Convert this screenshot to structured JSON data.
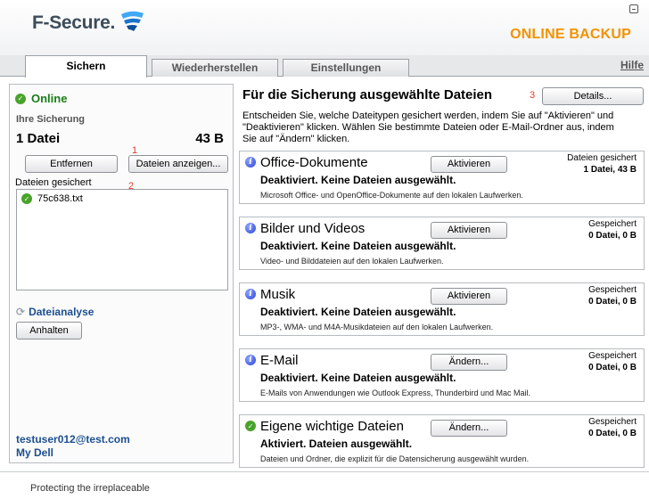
{
  "brand": {
    "name": "F-Secure.",
    "product": "ONLINE BACKUP"
  },
  "tabs": [
    {
      "label": "Sichern",
      "active": true
    },
    {
      "label": "Wiederherstellen",
      "active": false
    },
    {
      "label": "Einstellungen",
      "active": false
    }
  ],
  "help_label": "Hilfe",
  "left_panel": {
    "status": "Online",
    "backup_label": "Ihre Sicherung",
    "file_count": "1 Datei",
    "size": "43 B",
    "remove_button": "Entfernen",
    "show_files_button": "Dateien anzeigen...",
    "files_label": "Dateien gesichert",
    "files": [
      "75c638.txt"
    ],
    "analysis_label": "Dateianalyse",
    "pause_button": "Anhalten",
    "user_email": "testuser012@test.com",
    "user_link": "My Dell"
  },
  "annotations": {
    "one": "1",
    "two": "2",
    "three": "3"
  },
  "right_panel": {
    "title": "Für die Sicherung ausgewählte Dateien",
    "details_button": "Details...",
    "intro": "Entscheiden Sie, welche Dateitypen gesichert werden, indem Sie auf \"Aktivieren\" und \"Deaktivieren\" klicken. Wählen Sie bestimmte Dateien oder E-Mail-Ordner aus, indem Sie auf \"Ändern\" klicken.",
    "categories": [
      {
        "title": "Office-Dokumente",
        "status": "Deaktiviert. Keine Dateien ausgewählt.",
        "description": "Microsoft Office- und OpenOffice-Dokumente auf den lokalen Laufwerken.",
        "button": "Aktivieren",
        "meta_label": "Dateien gesichert",
        "meta_value": "1 Datei, 43 B",
        "icon": "info-icon"
      },
      {
        "title": "Bilder und Videos",
        "status": "Deaktiviert. Keine Dateien ausgewählt.",
        "description": "Video- und Bilddateien auf den lokalen Laufwerken.",
        "button": "Aktivieren",
        "meta_label": "Gespeichert",
        "meta_value": "0 Datei, 0 B",
        "icon": "info-icon"
      },
      {
        "title": "Musik",
        "status": "Deaktiviert. Keine Dateien ausgewählt.",
        "description": "MP3-, WMA- und M4A-Musikdateien auf den lokalen Laufwerken.",
        "button": "Aktivieren",
        "meta_label": "Gespeichert",
        "meta_value": "0 Datei, 0 B",
        "icon": "info-icon"
      },
      {
        "title": "E-Mail",
        "status": "Deaktiviert. Keine Dateien ausgewählt.",
        "description": "E-Mails von Anwendungen wie Outlook Express, Thunderbird und Mac Mail.",
        "button": "Ändern...",
        "meta_label": "Gespeichert",
        "meta_value": "0 Datei, 0 B",
        "icon": "info-icon"
      },
      {
        "title": "Eigene wichtige Dateien",
        "status": "Aktiviert. Dateien ausgewählt.",
        "description": "Dateien und Ordner, die explizit für die Datensicherung ausgewählt wurden.",
        "button": "Ändern...",
        "meta_label": "Gespeichert",
        "meta_value": "0 Datei, 0 B",
        "icon": "check-icon"
      }
    ]
  },
  "footer": {
    "tagline": "Protecting the irreplaceable"
  },
  "colors": {
    "accent_orange": "#f39200",
    "online_green": "#1a7c1a",
    "link_blue": "#1c4f8f"
  }
}
